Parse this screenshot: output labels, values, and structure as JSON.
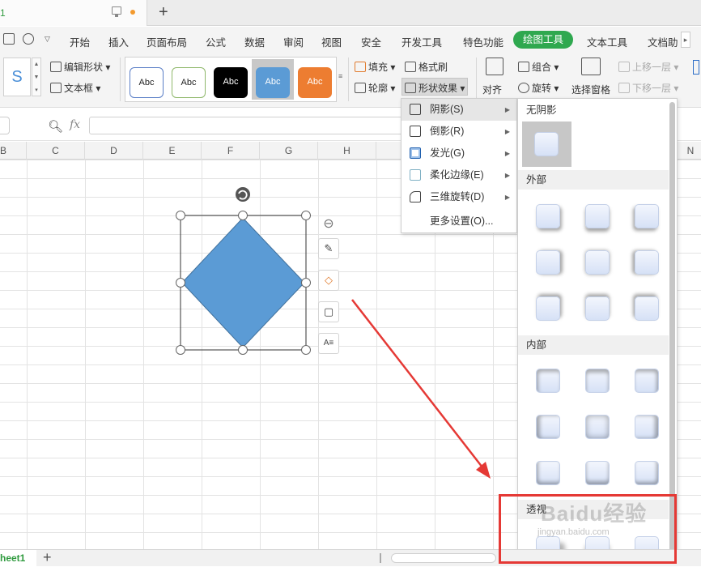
{
  "tabbar": {
    "doc_name": "1",
    "new_tab": "+"
  },
  "menubar": {
    "tabs": [
      "开始",
      "插入",
      "页面布局",
      "公式",
      "数据",
      "审阅",
      "视图",
      "安全",
      "开发工具",
      "特色功能",
      "绘图工具",
      "文本工具",
      "文档助"
    ],
    "active_tab": "绘图工具"
  },
  "ribbon": {
    "edit_shape": "编辑形状",
    "textbox": "文本框",
    "style_samples": [
      "Abc",
      "Abc",
      "Abc",
      "Abc",
      "Abc"
    ],
    "fill": "填充",
    "format_painter": "格式刷",
    "outline": "轮廓",
    "shape_effects": "形状效果",
    "align": "对齐",
    "group": "组合",
    "rotate": "旋转",
    "selection_pane": "选择窗格",
    "bring_forward": "上移一层",
    "send_backward": "下移一层"
  },
  "formula_bar": {
    "fx": "fx"
  },
  "columns": [
    "B",
    "C",
    "D",
    "E",
    "F",
    "G",
    "H",
    "N"
  ],
  "sheet": {
    "tab": "heet1",
    "add": "+"
  },
  "effects_menu": {
    "items": [
      {
        "label": "阴影(S)",
        "has_submenu": true,
        "active": true
      },
      {
        "label": "倒影(R)",
        "has_submenu": true
      },
      {
        "label": "发光(G)",
        "has_submenu": true
      },
      {
        "label": "柔化边缘(E)",
        "has_submenu": true
      },
      {
        "label": "三维旋转(D)",
        "has_submenu": true
      },
      {
        "label": "更多设置(O)...",
        "has_submenu": false
      }
    ]
  },
  "shadow_panel": {
    "no_shadow": "无阴影",
    "outer": "外部",
    "inner": "内部",
    "perspective": "透视"
  },
  "watermark": {
    "text": "Baidu经验",
    "url": "jingyan.baidu.com"
  },
  "colors": {
    "accent_green": "#2fa84f",
    "shape_fill": "#5b9bd5",
    "annotation_red": "#e53935"
  }
}
